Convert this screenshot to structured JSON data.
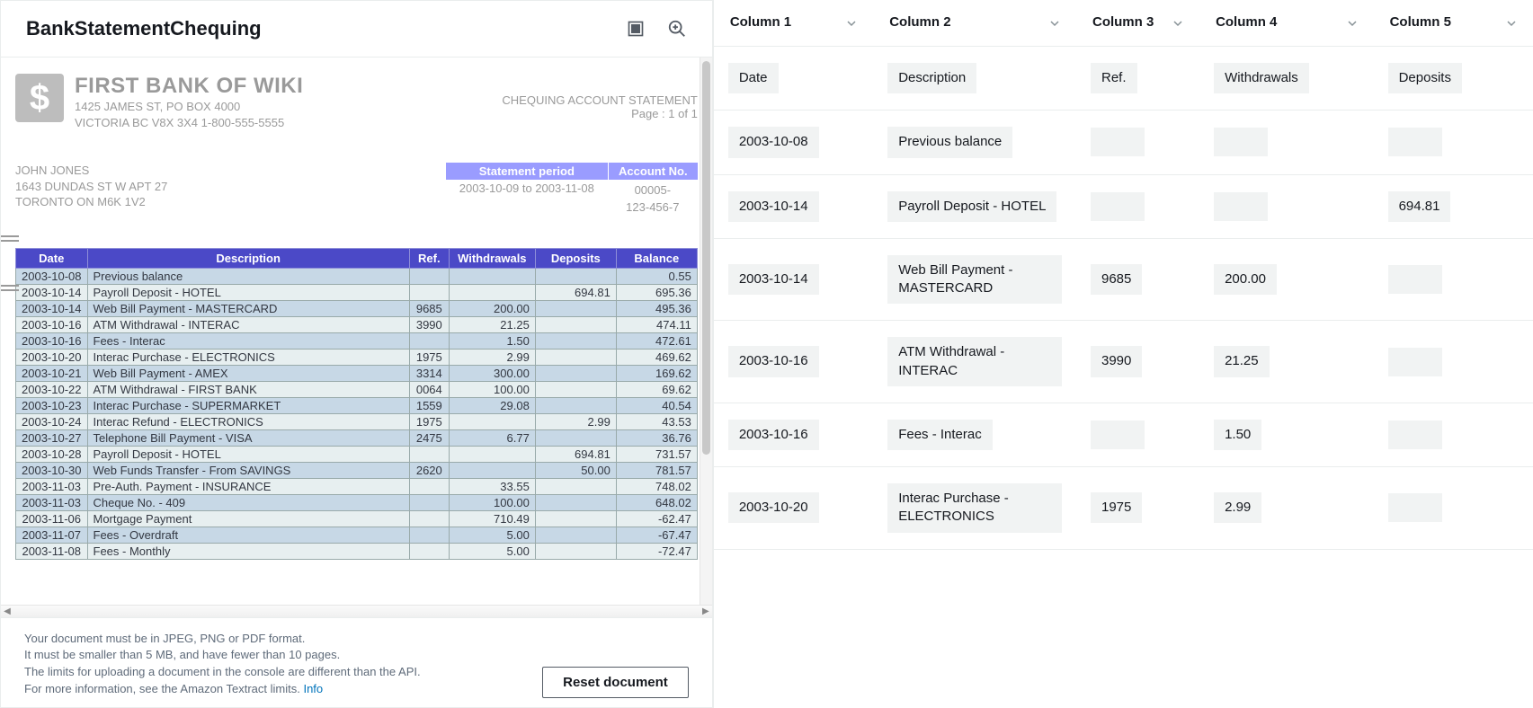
{
  "document_title": "BankStatementChequing",
  "footer_note_lines": [
    "Your document must be in JPEG, PNG or PDF format.",
    "It must be smaller than 5 MB, and have fewer than 10 pages.",
    "The limits for uploading a document in the console are different than the API."
  ],
  "footer_more": "For more information, see the Amazon Textract limits.",
  "footer_link": "Info",
  "reset_button": "Reset document",
  "bank": {
    "name": "FIRST BANK OF WIKI",
    "addr1": "1425 JAMES ST, PO BOX 4000",
    "addr2": "VICTORIA BC  V8X 3X4     1-800-555-5555",
    "stmt_type": "CHEQUING ACCOUNT STATEMENT",
    "page": "Page : 1 of 1",
    "customer_name": "JOHN JONES",
    "customer_addr1": "1643 DUNDAS ST W APT 27",
    "customer_addr2": "TORONTO ON   M6K 1V2",
    "period_label": "Statement period",
    "period_value": "2003-10-09 to 2003-11-08",
    "acct_label": "Account No.",
    "acct_value1": "00005-",
    "acct_value2": "123-456-7"
  },
  "stmt_headers": [
    "Date",
    "Description",
    "Ref.",
    "Withdrawals",
    "Deposits",
    "Balance"
  ],
  "stmt_rows": [
    {
      "date": "2003-10-08",
      "desc": "Previous balance",
      "ref": "",
      "w": "",
      "d": "",
      "b": "0.55"
    },
    {
      "date": "2003-10-14",
      "desc": "Payroll Deposit - HOTEL",
      "ref": "",
      "w": "",
      "d": "694.81",
      "b": "695.36"
    },
    {
      "date": "2003-10-14",
      "desc": "Web Bill Payment - MASTERCARD",
      "ref": "9685",
      "w": "200.00",
      "d": "",
      "b": "495.36"
    },
    {
      "date": "2003-10-16",
      "desc": "ATM Withdrawal - INTERAC",
      "ref": "3990",
      "w": "21.25",
      "d": "",
      "b": "474.11"
    },
    {
      "date": "2003-10-16",
      "desc": "Fees - Interac",
      "ref": "",
      "w": "1.50",
      "d": "",
      "b": "472.61"
    },
    {
      "date": "2003-10-20",
      "desc": "Interac Purchase - ELECTRONICS",
      "ref": "1975",
      "w": "2.99",
      "d": "",
      "b": "469.62"
    },
    {
      "date": "2003-10-21",
      "desc": "Web Bill Payment - AMEX",
      "ref": "3314",
      "w": "300.00",
      "d": "",
      "b": "169.62"
    },
    {
      "date": "2003-10-22",
      "desc": "ATM Withdrawal - FIRST BANK",
      "ref": "0064",
      "w": "100.00",
      "d": "",
      "b": "69.62"
    },
    {
      "date": "2003-10-23",
      "desc": "Interac Purchase - SUPERMARKET",
      "ref": "1559",
      "w": "29.08",
      "d": "",
      "b": "40.54"
    },
    {
      "date": "2003-10-24",
      "desc": "Interac Refund - ELECTRONICS",
      "ref": "1975",
      "w": "",
      "d": "2.99",
      "b": "43.53"
    },
    {
      "date": "2003-10-27",
      "desc": "Telephone Bill Payment - VISA",
      "ref": "2475",
      "w": "6.77",
      "d": "",
      "b": "36.76"
    },
    {
      "date": "2003-10-28",
      "desc": "Payroll Deposit - HOTEL",
      "ref": "",
      "w": "",
      "d": "694.81",
      "b": "731.57"
    },
    {
      "date": "2003-10-30",
      "desc": "Web Funds Transfer - From  SAVINGS",
      "ref": "2620",
      "w": "",
      "d": "50.00",
      "b": "781.57"
    },
    {
      "date": "2003-11-03",
      "desc": "Pre-Auth. Payment - INSURANCE",
      "ref": "",
      "w": "33.55",
      "d": "",
      "b": "748.02"
    },
    {
      "date": "2003-11-03",
      "desc": "Cheque No. - 409",
      "ref": "",
      "w": "100.00",
      "d": "",
      "b": "648.02"
    },
    {
      "date": "2003-11-06",
      "desc": "Mortgage Payment",
      "ref": "",
      "w": "710.49",
      "d": "",
      "b": "-62.47"
    },
    {
      "date": "2003-11-07",
      "desc": "Fees - Overdraft",
      "ref": "",
      "w": "5.00",
      "d": "",
      "b": "-67.47"
    },
    {
      "date": "2003-11-08",
      "desc": "Fees - Monthly",
      "ref": "",
      "w": "5.00",
      "d": "",
      "b": "-72.47"
    }
  ],
  "grid_columns": [
    "Column 1",
    "Column 2",
    "Column 3",
    "Column 4",
    "Column 5"
  ],
  "grid_header_row": [
    "Date",
    "Description",
    "Ref.",
    "Withdrawals",
    "Deposits"
  ],
  "grid_rows": [
    {
      "c1": "2003-10-08",
      "c2": "Previous balance",
      "c3": "",
      "c4": "",
      "c5": ""
    },
    {
      "c1": "2003-10-14",
      "c2": "Payroll Deposit - HOTEL",
      "c3": "",
      "c4": "",
      "c5": "694.81"
    },
    {
      "c1": "2003-10-14",
      "c2": "Web Bill Payment - MASTERCARD",
      "c3": "9685",
      "c4": "200.00",
      "c5": ""
    },
    {
      "c1": "2003-10-16",
      "c2": "ATM Withdrawal - INTERAC",
      "c3": "3990",
      "c4": "21.25",
      "c5": ""
    },
    {
      "c1": "2003-10-16",
      "c2": "Fees - Interac",
      "c3": "",
      "c4": "1.50",
      "c5": ""
    },
    {
      "c1": "2003-10-20",
      "c2": "Interac Purchase - ELECTRONICS",
      "c3": "1975",
      "c4": "2.99",
      "c5": ""
    }
  ]
}
